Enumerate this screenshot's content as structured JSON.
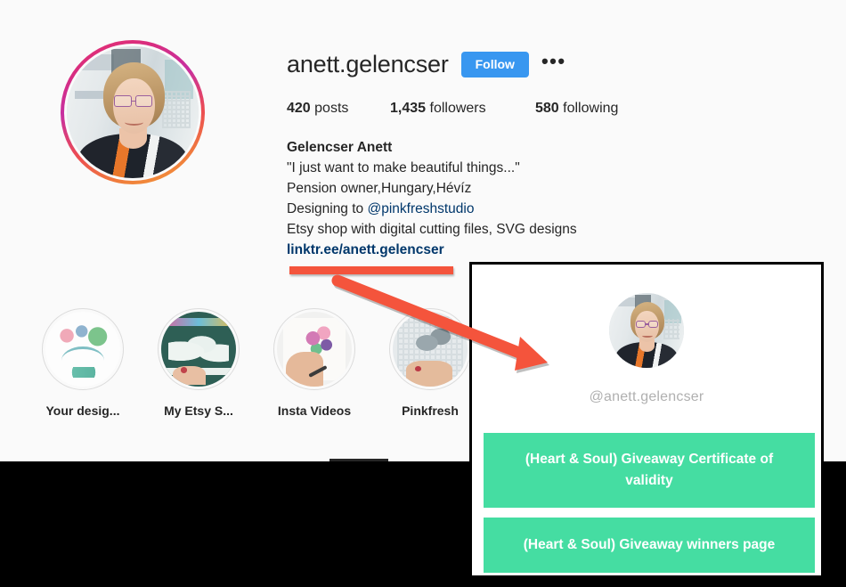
{
  "profile": {
    "username": "anett.gelencser",
    "follow_label": "Follow",
    "more_icon": "•••",
    "stats": {
      "posts_count": "420",
      "posts_label": "posts",
      "followers_count": "1,435",
      "followers_label": "followers",
      "following_count": "580",
      "following_label": "following"
    },
    "bio": {
      "full_name": "Gelencser Anett",
      "line_1": "\"I just want to make beautiful things...\"",
      "line_2": "Pension owner,Hungary,Hévíz",
      "line_3_prefix": "Designing to ",
      "line_3_mention": "@pinkfreshstudio",
      "line_4": "Etsy shop with digital cutting files, SVG designs",
      "url": "linktr.ee/anett.gelencser"
    }
  },
  "highlights": [
    {
      "label": "Your designs",
      "display": "Your desig..."
    },
    {
      "label": "My Etsy Shop",
      "display": "My Etsy S..."
    },
    {
      "label": "Insta Videos",
      "display": "Insta Videos"
    },
    {
      "label": "Pinkfresh",
      "display": "Pinkfresh"
    }
  ],
  "linktree": {
    "handle": "@anett.gelencser",
    "links": [
      "(Heart & Soul) Giveaway Certificate of validity",
      "(Heart & Soul) Giveaway winners page"
    ]
  },
  "annotation": {
    "color": "#f4543c",
    "type": "arrow-pointing-from-bio-link-to-linktree-panel"
  },
  "colors": {
    "page_background": "#fafafa",
    "follow_blue": "#3897f0",
    "link_blue": "#00376b",
    "linktree_green": "#45dda2",
    "annotation_red": "#f4543c",
    "text_primary": "#262626",
    "panel_border": "#000000"
  }
}
